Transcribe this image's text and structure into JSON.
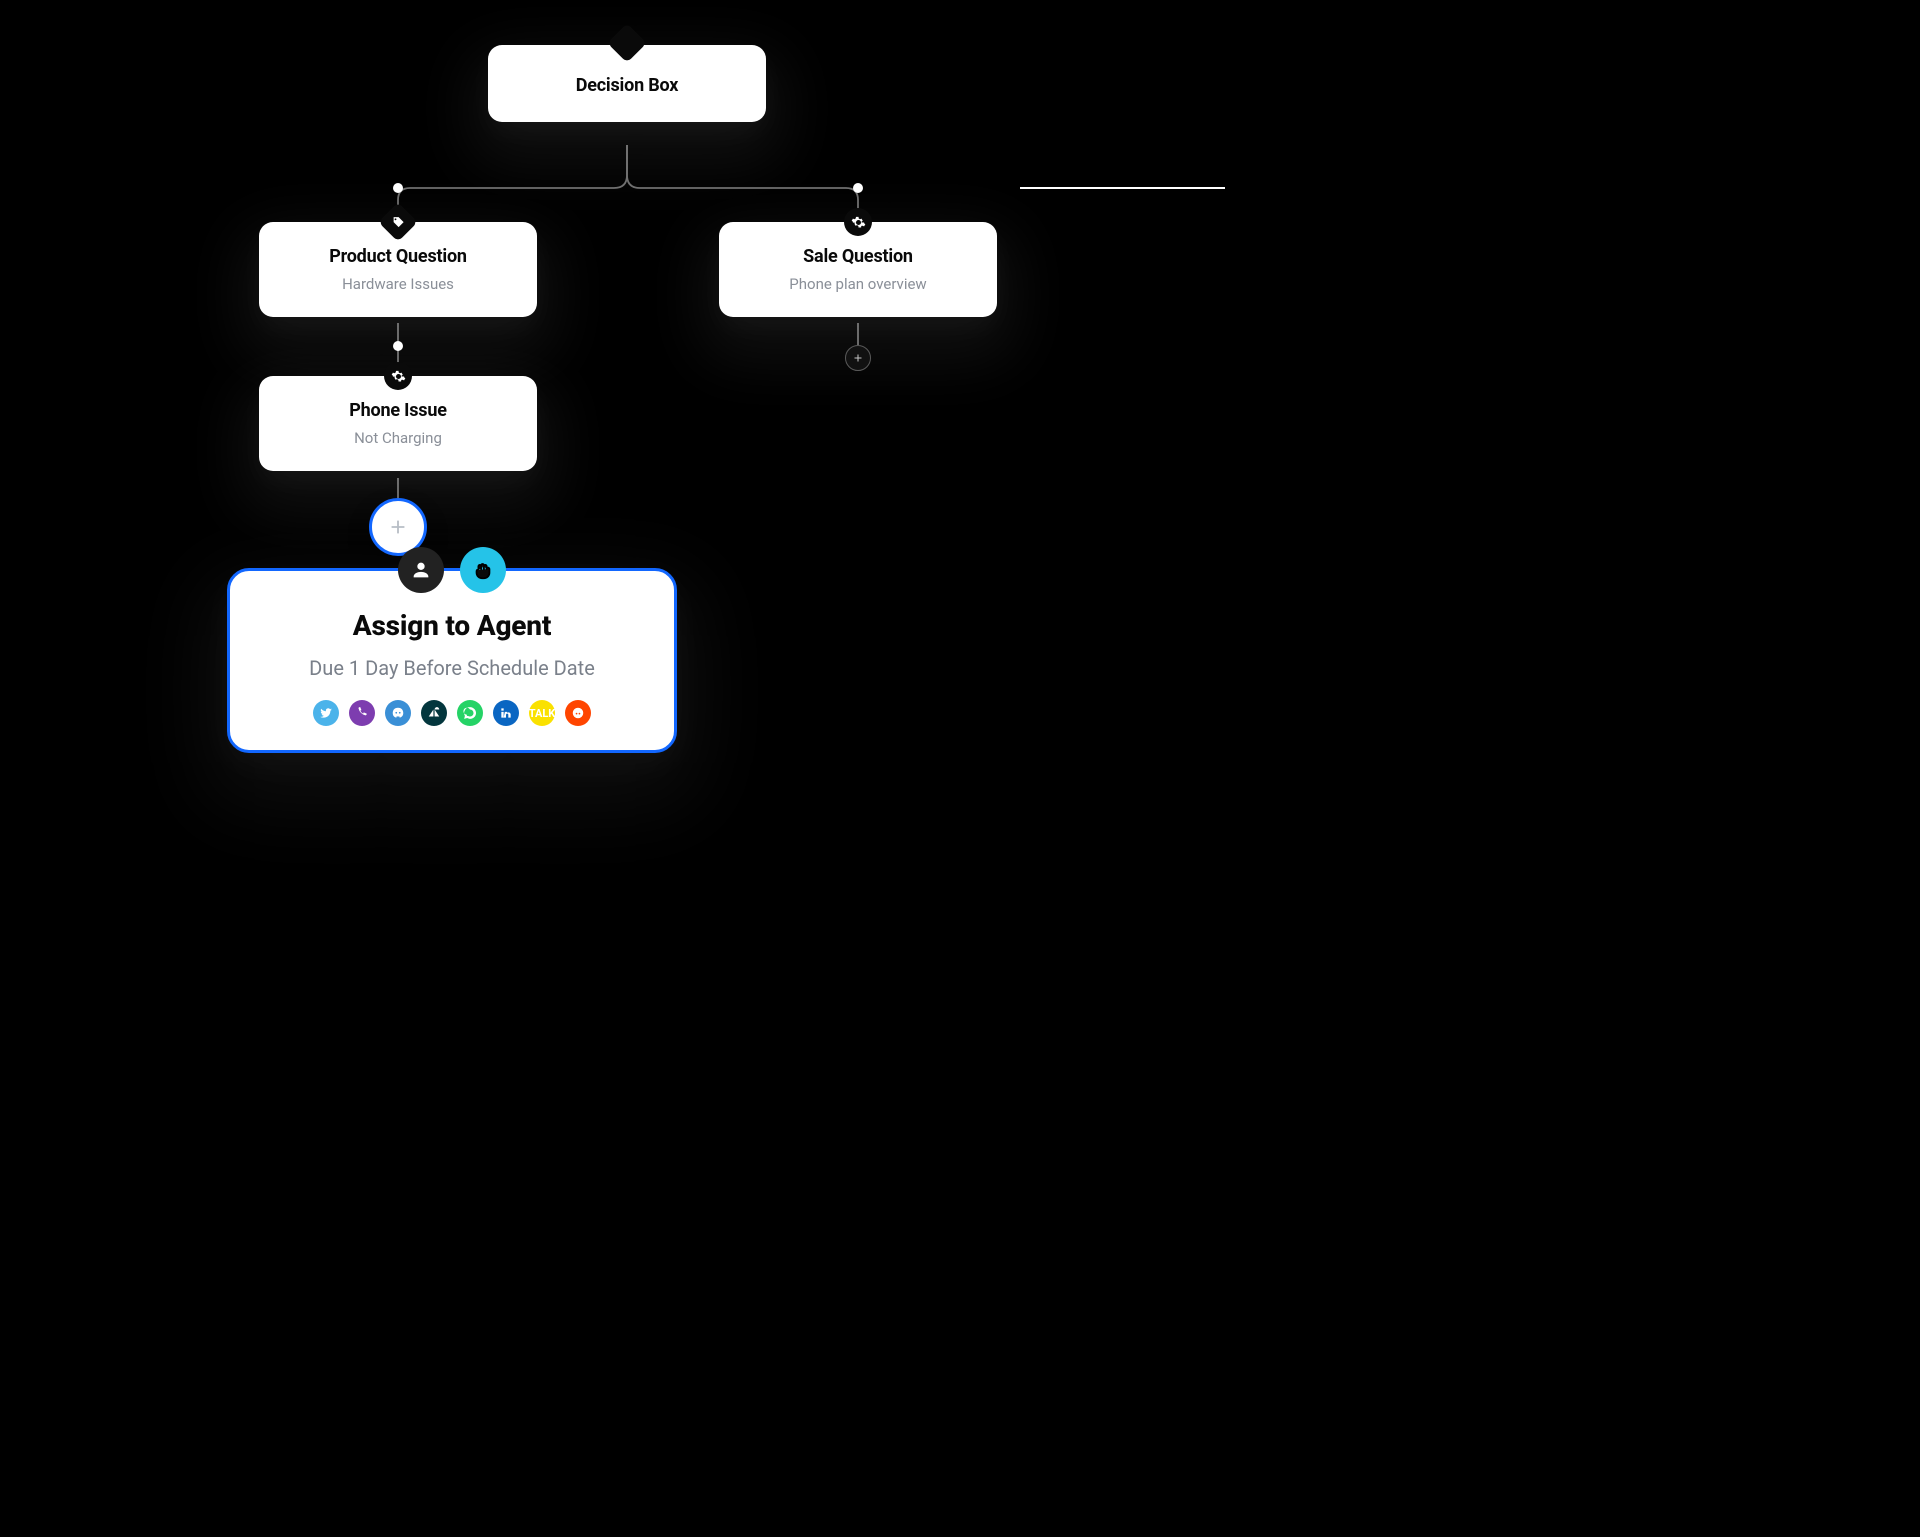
{
  "root": {
    "title": "Decision Box"
  },
  "left_branch": {
    "node1": {
      "title": "Product Question",
      "subtitle": "Hardware Issues"
    },
    "node2": {
      "title": "Phone Issue",
      "subtitle": "Not Charging"
    }
  },
  "right_branch": {
    "node1": {
      "title": "Sale Question",
      "subtitle": "Phone plan overview"
    }
  },
  "assign_card": {
    "title": "Assign to Agent",
    "subtitle": "Due 1 Day Before Schedule Date",
    "integrations": [
      {
        "name": "twitter",
        "label": "t"
      },
      {
        "name": "viber",
        "label": "v"
      },
      {
        "name": "discord",
        "label": "d"
      },
      {
        "name": "zendesk",
        "label": "z"
      },
      {
        "name": "whatsapp",
        "label": "b"
      },
      {
        "name": "linkedin",
        "label": "in"
      },
      {
        "name": "kakao",
        "label": "TALK"
      },
      {
        "name": "reddit",
        "label": "r"
      }
    ]
  },
  "icons": {
    "root_badge": "diamond-icon",
    "product_badge": "tag-icon",
    "phone_badge": "gear-icon",
    "sale_badge": "gear-icon",
    "assign_person": "person-icon",
    "assign_hand": "grab-hand-icon"
  },
  "colors": {
    "accent": "#1267ff",
    "cyan": "#25c3e8"
  }
}
